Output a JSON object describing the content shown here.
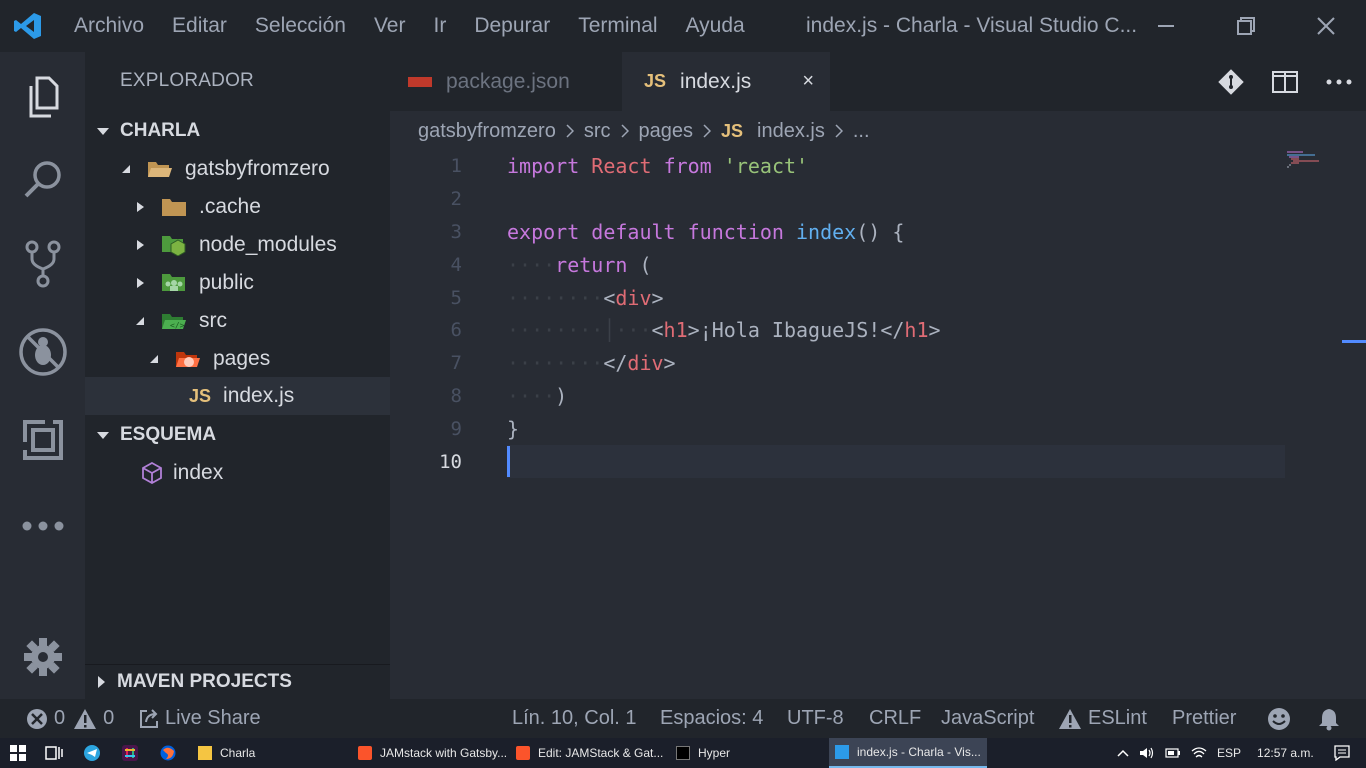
{
  "titlebar": {
    "menu": [
      "Archivo",
      "Editar",
      "Selección",
      "Ver",
      "Ir",
      "Depurar",
      "Terminal",
      "Ayuda"
    ],
    "window_title": "index.js - Charla - Visual Studio C..."
  },
  "activity_bar": [
    "explorer-icon",
    "search-icon",
    "source-control-icon",
    "debug-icon",
    "extensions-icon",
    "more-icon",
    "gear-icon"
  ],
  "sidebar": {
    "title": "EXPLORADOR",
    "project_section": "CHARLA",
    "tree": [
      {
        "label": "gatsbyfromzero",
        "icon": "folder-open-icon"
      },
      {
        "label": ".cache",
        "icon": "folder-icon"
      },
      {
        "label": "node_modules",
        "icon": "node-folder-icon"
      },
      {
        "label": "public",
        "icon": "public-folder-icon"
      },
      {
        "label": "src",
        "icon": "src-folder-icon"
      },
      {
        "label": "pages",
        "icon": "pages-folder-icon"
      },
      {
        "label": "index.js",
        "icon": "js-file-icon",
        "badge": "JS"
      }
    ],
    "outline_section": "ESQUEMA",
    "outline_items": [
      {
        "label": "index",
        "icon": "cube-icon"
      }
    ],
    "maven_section": "MAVEN PROJECTS"
  },
  "tabs": [
    {
      "label": "package.json",
      "active": false
    },
    {
      "label": "index.js",
      "active": true,
      "badge": "JS",
      "close": "×"
    }
  ],
  "breadcrumb": {
    "items": [
      "gatsbyfromzero",
      "src",
      "pages",
      "index.js",
      "..."
    ],
    "badge": "JS"
  },
  "editor": {
    "line_numbers": [
      "1",
      "2",
      "3",
      "4",
      "5",
      "6",
      "7",
      "8",
      "9",
      "10"
    ],
    "active_line": 10,
    "line1": {
      "kw_import": "import",
      "id_react": "React",
      "kw_from": "from",
      "str_react": "'react'"
    },
    "line3": {
      "kw_export": "export",
      "kw_default": "default",
      "kw_function": "function",
      "fn_name": "index",
      "punct": "() {"
    },
    "line4": {
      "ws": "····",
      "kw_return": "return",
      "punct": "("
    },
    "line5": {
      "ws": "········",
      "open": "<",
      "tag": "div",
      "close": ">"
    },
    "line6": {
      "ws": "········│···",
      "open": "<",
      "tag": "h1",
      "close": ">",
      "text": "¡Hola IbagueJS!",
      "end_open": "</",
      "end_tag": "h1",
      "end_close": ">"
    },
    "line7": {
      "ws": "········",
      "open": "</",
      "tag": "div",
      "close": ">"
    },
    "line8": {
      "ws": "····",
      "punct": ")"
    },
    "line9": {
      "punct": "}"
    }
  },
  "statusbar": {
    "errors": "0",
    "warnings": "0",
    "live_share": "Live Share",
    "position": "Lín. 10, Col. 1",
    "spaces": "Espacios: 4",
    "encoding": "UTF-8",
    "eol": "CRLF",
    "language": "JavaScript",
    "eslint": "ESLint",
    "prettier": "Prettier"
  },
  "taskbar": {
    "tasks": [
      {
        "label": "Charla",
        "icon": "folder-icon"
      },
      {
        "label": "JAMstack with Gatsby...",
        "icon": "brave-icon"
      },
      {
        "label": "Edit: JAMStack & Gat...",
        "icon": "brave-icon"
      },
      {
        "label": "Hyper",
        "icon": "terminal-icon"
      },
      {
        "label": "index.js - Charla - Vis...",
        "icon": "vscode-icon",
        "active": true
      }
    ],
    "language": "ESP",
    "time": "12:57 a.m."
  },
  "colors": {
    "accent": "#528bff",
    "keyword": "#c678dd",
    "identifier": "#e06c75",
    "string": "#98c379",
    "function": "#61afef",
    "js_badge": "#e5c07b"
  }
}
